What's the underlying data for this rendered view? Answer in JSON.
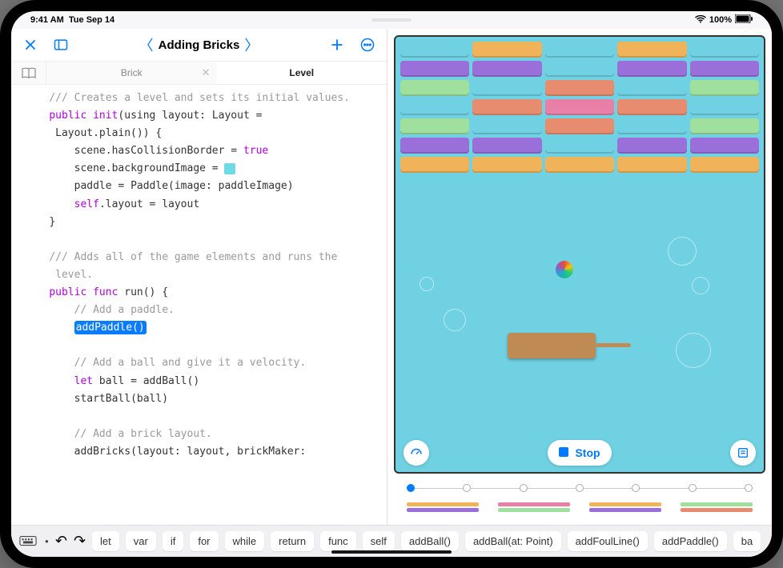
{
  "status": {
    "time": "9:41 AM",
    "date": "Tue Sep 14",
    "battery": "100%"
  },
  "header": {
    "title": "Adding Bricks"
  },
  "tabs": {
    "tab1": "Brick",
    "tab2": "Level"
  },
  "code": {
    "l1": "/// Creates a level and sets its initial values.",
    "l2a": "public",
    "l2b": "init",
    "l2c": "(using layout: Layout =",
    "l3": " Layout.plain()) {",
    "l4a": "scene.hasCollisionBorder = ",
    "l4b": "true",
    "l5": "scene.backgroundImage = ",
    "l6": "paddle = Paddle(image: paddleImage)",
    "l7a": "self",
    "l7b": ".layout = layout",
    "l8": "}",
    "l9a": "/// Adds all of the game elements and runs the",
    "l9b": " level.",
    "l10a": "public",
    "l10b": "func",
    "l10c": " run() {",
    "l11": "// Add a paddle.",
    "l12": "addPaddle()",
    "l13": "// Add a ball and give it a velocity.",
    "l14a": "let",
    "l14b": " ball = addBall()",
    "l15": "startBall(ball)",
    "l16": "// Add a brick layout.",
    "l17": "addBricks(layout: layout, brickMaker:"
  },
  "game": {
    "stop_label": "Stop"
  },
  "kbar": {
    "items": [
      "let",
      "var",
      "if",
      "for",
      "while",
      "return",
      "func",
      "self",
      "addBall()",
      "addBall(at: Point)",
      "addFoulLine()",
      "addPaddle()",
      "ba"
    ]
  }
}
